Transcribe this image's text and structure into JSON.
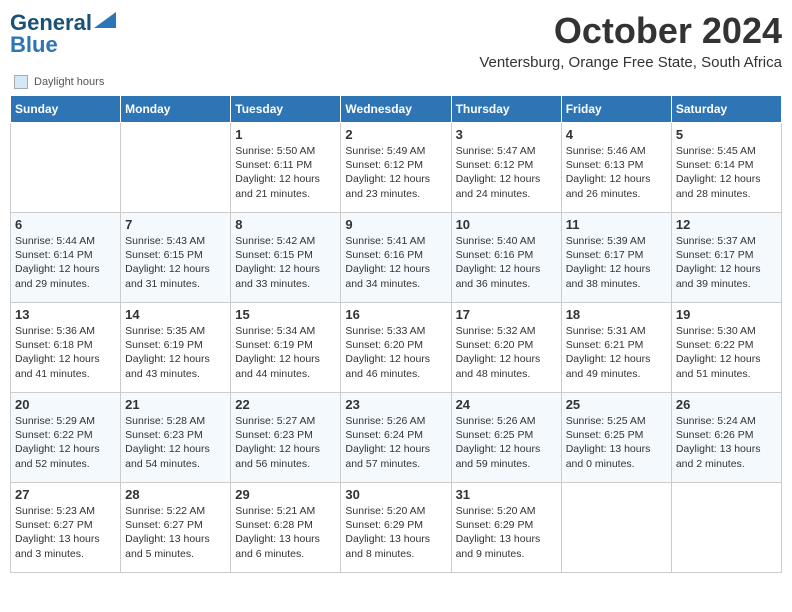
{
  "logo": {
    "line1": "General",
    "line2": "Blue"
  },
  "title": "October 2024",
  "subtitle": "Ventersburg, Orange Free State, South Africa",
  "legend_text": "Daylight hours",
  "days_of_week": [
    "Sunday",
    "Monday",
    "Tuesday",
    "Wednesday",
    "Thursday",
    "Friday",
    "Saturday"
  ],
  "weeks": [
    [
      {
        "day": "",
        "content": ""
      },
      {
        "day": "",
        "content": ""
      },
      {
        "day": "1",
        "content": "Sunrise: 5:50 AM\nSunset: 6:11 PM\nDaylight: 12 hours and 21 minutes."
      },
      {
        "day": "2",
        "content": "Sunrise: 5:49 AM\nSunset: 6:12 PM\nDaylight: 12 hours and 23 minutes."
      },
      {
        "day": "3",
        "content": "Sunrise: 5:47 AM\nSunset: 6:12 PM\nDaylight: 12 hours and 24 minutes."
      },
      {
        "day": "4",
        "content": "Sunrise: 5:46 AM\nSunset: 6:13 PM\nDaylight: 12 hours and 26 minutes."
      },
      {
        "day": "5",
        "content": "Sunrise: 5:45 AM\nSunset: 6:14 PM\nDaylight: 12 hours and 28 minutes."
      }
    ],
    [
      {
        "day": "6",
        "content": "Sunrise: 5:44 AM\nSunset: 6:14 PM\nDaylight: 12 hours and 29 minutes."
      },
      {
        "day": "7",
        "content": "Sunrise: 5:43 AM\nSunset: 6:15 PM\nDaylight: 12 hours and 31 minutes."
      },
      {
        "day": "8",
        "content": "Sunrise: 5:42 AM\nSunset: 6:15 PM\nDaylight: 12 hours and 33 minutes."
      },
      {
        "day": "9",
        "content": "Sunrise: 5:41 AM\nSunset: 6:16 PM\nDaylight: 12 hours and 34 minutes."
      },
      {
        "day": "10",
        "content": "Sunrise: 5:40 AM\nSunset: 6:16 PM\nDaylight: 12 hours and 36 minutes."
      },
      {
        "day": "11",
        "content": "Sunrise: 5:39 AM\nSunset: 6:17 PM\nDaylight: 12 hours and 38 minutes."
      },
      {
        "day": "12",
        "content": "Sunrise: 5:37 AM\nSunset: 6:17 PM\nDaylight: 12 hours and 39 minutes."
      }
    ],
    [
      {
        "day": "13",
        "content": "Sunrise: 5:36 AM\nSunset: 6:18 PM\nDaylight: 12 hours and 41 minutes."
      },
      {
        "day": "14",
        "content": "Sunrise: 5:35 AM\nSunset: 6:19 PM\nDaylight: 12 hours and 43 minutes."
      },
      {
        "day": "15",
        "content": "Sunrise: 5:34 AM\nSunset: 6:19 PM\nDaylight: 12 hours and 44 minutes."
      },
      {
        "day": "16",
        "content": "Sunrise: 5:33 AM\nSunset: 6:20 PM\nDaylight: 12 hours and 46 minutes."
      },
      {
        "day": "17",
        "content": "Sunrise: 5:32 AM\nSunset: 6:20 PM\nDaylight: 12 hours and 48 minutes."
      },
      {
        "day": "18",
        "content": "Sunrise: 5:31 AM\nSunset: 6:21 PM\nDaylight: 12 hours and 49 minutes."
      },
      {
        "day": "19",
        "content": "Sunrise: 5:30 AM\nSunset: 6:22 PM\nDaylight: 12 hours and 51 minutes."
      }
    ],
    [
      {
        "day": "20",
        "content": "Sunrise: 5:29 AM\nSunset: 6:22 PM\nDaylight: 12 hours and 52 minutes."
      },
      {
        "day": "21",
        "content": "Sunrise: 5:28 AM\nSunset: 6:23 PM\nDaylight: 12 hours and 54 minutes."
      },
      {
        "day": "22",
        "content": "Sunrise: 5:27 AM\nSunset: 6:23 PM\nDaylight: 12 hours and 56 minutes."
      },
      {
        "day": "23",
        "content": "Sunrise: 5:26 AM\nSunset: 6:24 PM\nDaylight: 12 hours and 57 minutes."
      },
      {
        "day": "24",
        "content": "Sunrise: 5:26 AM\nSunset: 6:25 PM\nDaylight: 12 hours and 59 minutes."
      },
      {
        "day": "25",
        "content": "Sunrise: 5:25 AM\nSunset: 6:25 PM\nDaylight: 13 hours and 0 minutes."
      },
      {
        "day": "26",
        "content": "Sunrise: 5:24 AM\nSunset: 6:26 PM\nDaylight: 13 hours and 2 minutes."
      }
    ],
    [
      {
        "day": "27",
        "content": "Sunrise: 5:23 AM\nSunset: 6:27 PM\nDaylight: 13 hours and 3 minutes."
      },
      {
        "day": "28",
        "content": "Sunrise: 5:22 AM\nSunset: 6:27 PM\nDaylight: 13 hours and 5 minutes."
      },
      {
        "day": "29",
        "content": "Sunrise: 5:21 AM\nSunset: 6:28 PM\nDaylight: 13 hours and 6 minutes."
      },
      {
        "day": "30",
        "content": "Sunrise: 5:20 AM\nSunset: 6:29 PM\nDaylight: 13 hours and 8 minutes."
      },
      {
        "day": "31",
        "content": "Sunrise: 5:20 AM\nSunset: 6:29 PM\nDaylight: 13 hours and 9 minutes."
      },
      {
        "day": "",
        "content": ""
      },
      {
        "day": "",
        "content": ""
      }
    ]
  ]
}
